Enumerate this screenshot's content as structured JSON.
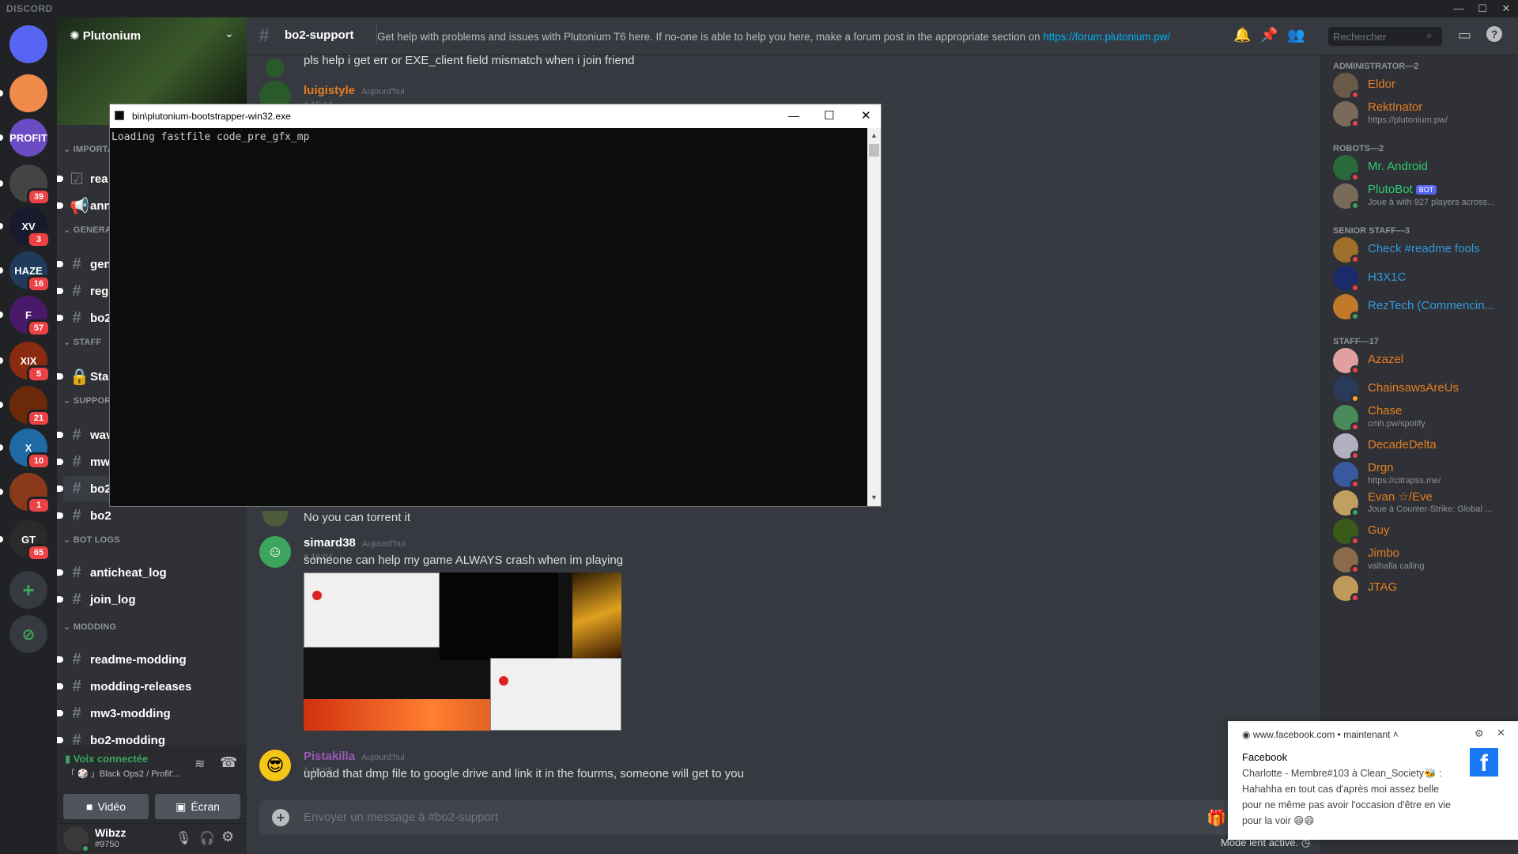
{
  "app": {
    "brand": "DISCORD",
    "window_controls": [
      "—",
      "☐",
      "✕"
    ]
  },
  "guilds": [
    {
      "label": "",
      "badge": "",
      "color": "#5865f2",
      "icon": "discord-home-icon"
    },
    {
      "label": "",
      "badge": "",
      "color": "#f08a4b"
    },
    {
      "label": "PROFIT",
      "badge": "",
      "color": "#6b4cc4"
    },
    {
      "label": "",
      "badge": "39",
      "color": "#444"
    },
    {
      "label": "XV",
      "badge": "3",
      "color": "#1a1a2e"
    },
    {
      "label": "HAZE",
      "badge": "16",
      "color": "#1f3a5a"
    },
    {
      "label": "F",
      "badge": "57",
      "color": "#4a1a6a"
    },
    {
      "label": "XIX",
      "badge": "5",
      "color": "#8a2a10"
    },
    {
      "label": "",
      "badge": "21",
      "color": "#6a2a0a"
    },
    {
      "label": "X",
      "badge": "10",
      "color": "#1f6aa5"
    },
    {
      "label": "",
      "badge": "1",
      "color": "#8a3a1a"
    },
    {
      "label": "GT",
      "badge": "65",
      "color": "#2a2a2a"
    }
  ],
  "server": {
    "name": "Plutonium",
    "categories": [
      {
        "name": "IMPORTA",
        "channels": [
          {
            "name": "rea",
            "icon": "checkbox-icon"
          },
          {
            "name": "ann",
            "icon": "megaphone-icon"
          }
        ]
      },
      {
        "name": "GENERAL",
        "channels": [
          {
            "name": "gen"
          },
          {
            "name": "regi"
          },
          {
            "name": "bo2"
          }
        ]
      },
      {
        "name": "STAFF",
        "channels": [
          {
            "name": "Sta",
            "icon": "lock-icon"
          }
        ]
      },
      {
        "name": "SUPPORT",
        "channels": [
          {
            "name": "wav"
          },
          {
            "name": "mw"
          },
          {
            "name": "bo2"
          },
          {
            "name": "bo2"
          }
        ]
      },
      {
        "name": "BOT LOGS",
        "channels": [
          {
            "name": "anticheat_log"
          },
          {
            "name": "join_log"
          }
        ]
      },
      {
        "name": "MODDING",
        "channels": [
          {
            "name": "readme-modding"
          },
          {
            "name": "modding-releases"
          },
          {
            "name": "mw3-modding"
          },
          {
            "name": "bo2-modding"
          }
        ]
      }
    ]
  },
  "voice": {
    "status": "Voix connectée",
    "channel": "「 🎲 」Black Ops2 / Profit'...",
    "video": "Vidéo",
    "screen": "Écran"
  },
  "user": {
    "name": "Wibzz",
    "tag": "#9750"
  },
  "header": {
    "channel": "bo2-support",
    "topic": "Get help with problems and issues with Plutonium T6 here. If no-one is able to help you here, make a forum post in the appropriate section on ",
    "topic_link": "https://forum.plutonium.pw/",
    "search_placeholder": "Rechercher"
  },
  "messages": {
    "partial_top": "pls help i get err or EXE_client field mismatch when i join friend",
    "luigi": {
      "author": "luigistyle",
      "time": "Aujourd'hui à 15:14"
    },
    "partial_mid": "No you can torrent it",
    "simard": {
      "author": "simard38",
      "time": "Aujourd'hui à 16:04",
      "text": "someone can help my game ALWAYS crash when im playing"
    },
    "pistakilla": {
      "author": "Pistakilla",
      "time": "Aujourd'hui à 16:05",
      "text": "upload that dmp file to google drive and link it in the fourms, someone will get to you"
    }
  },
  "composer": {
    "placeholder": "Envoyer un message à #bo2-support"
  },
  "members": {
    "groups": [
      {
        "title": "ADMINISTRATOR—2",
        "items": [
          {
            "name": "Eldor",
            "sub": "",
            "color": "#e67e22",
            "av": "#6b5a4a",
            "st": "#ed4245"
          },
          {
            "name": "RektInator",
            "sub": "https://plutonium.pw/",
            "color": "#e67e22",
            "av": "#7a6a5a",
            "st": "#ed4245"
          }
        ]
      },
      {
        "title": "ROBOTS—2",
        "items": [
          {
            "name": "Mr. Android",
            "sub": "",
            "color": "#2ecc71",
            "av": "#2a6a3a",
            "st": "#ed4245"
          },
          {
            "name": "PlutoBot",
            "sub": "Joue à with 927 players across...",
            "color": "#2ecc71",
            "av": "#7a6a5a",
            "st": "#3ba55d",
            "bot": "BOT"
          }
        ]
      },
      {
        "title": "SENIOR STAFF—3",
        "items": [
          {
            "name": "Check #readme fools",
            "sub": "",
            "color": "#3498db",
            "av": "#a0702a",
            "st": "#ed4245"
          },
          {
            "name": "H3X1C",
            "sub": "",
            "color": "#3498db",
            "av": "#1a2a6a",
            "st": "#ed4245"
          },
          {
            "name": "RezTech (Commencin...",
            "sub": "",
            "color": "#3498db",
            "av": "#c07a2a",
            "st": "#3ba55d"
          }
        ]
      },
      {
        "title": "STAFF—17",
        "items": [
          {
            "name": "Azazel",
            "sub": "",
            "color": "#e67e22",
            "av": "#e0a0a0",
            "st": "#ed4245"
          },
          {
            "name": "ChainsawsAreUs",
            "sub": "",
            "color": "#e67e22",
            "av": "#2a3a5a",
            "st": "#faa61a"
          },
          {
            "name": "Chase",
            "sub": "cmh.pw/spotify",
            "color": "#e67e22",
            "av": "#4a8a5a",
            "st": "#ed4245"
          },
          {
            "name": "DecadeDelta",
            "sub": "",
            "color": "#e67e22",
            "av": "#b0b0c0",
            "st": "#ed4245"
          },
          {
            "name": "Drgn",
            "sub": "https://citrapss.me/",
            "color": "#e67e22",
            "av": "#3a5aa0",
            "st": "#ed4245"
          },
          {
            "name": "Evan ☆/Eve",
            "sub": "Joue à Counter-Strike: Global ...",
            "color": "#e67e22",
            "av": "#c0a060",
            "st": "#3ba55d"
          },
          {
            "name": "Guy",
            "sub": "",
            "color": "#e67e22",
            "av": "#3a5a1a",
            "st": "#ed4245"
          },
          {
            "name": "Jimbo",
            "sub": "valhalla calling",
            "color": "#e67e22",
            "av": "#8a6a4a",
            "st": "#ed4245"
          },
          {
            "name": "JTAG",
            "sub": "",
            "color": "#e67e22",
            "av": "#c09a5a",
            "st": "#ed4245"
          }
        ]
      }
    ]
  },
  "console": {
    "title": "bin\\plutonium-bootstrapper-win32.exe",
    "text": "Loading fastfile code_pre_gfx_mp"
  },
  "notification": {
    "source": "www.facebook.com",
    "when": "maintenant",
    "app": "Facebook",
    "body": "Charlotte - Membre#103 à Clean_Society🐝 : Hahahha en tout cas d'après moi assez belle pour ne même pas avoir l'occasion d'être en vie pour la voir 😄😄"
  },
  "footer": {
    "slowmode": "Mode lent activé."
  },
  "colors": {
    "accent": "#5865f2",
    "link": "#00b0f4",
    "danger": "#ed4245",
    "online": "#3ba55d"
  }
}
